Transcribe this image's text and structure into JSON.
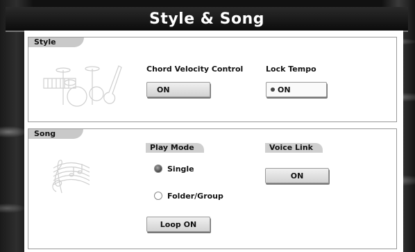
{
  "title": "Style & Song",
  "style": {
    "tab_label": "Style",
    "chord_velocity_label": "Chord Velocity Control",
    "chord_velocity_value": "ON",
    "lock_tempo_label": "Lock Tempo",
    "lock_tempo_value": "ON"
  },
  "song": {
    "tab_label": "Song",
    "play_mode_label": "Play Mode",
    "mode_single": "Single",
    "mode_folder": "Folder/Group",
    "selected_mode": "Single",
    "voice_link_label": "Voice Link",
    "voice_link_value": "ON",
    "loop_label": "Loop ON"
  },
  "icons": {
    "style_icon": "drum-kit-keyboard-guitar-icon",
    "song_icon": "treble-clef-staff-icon"
  }
}
